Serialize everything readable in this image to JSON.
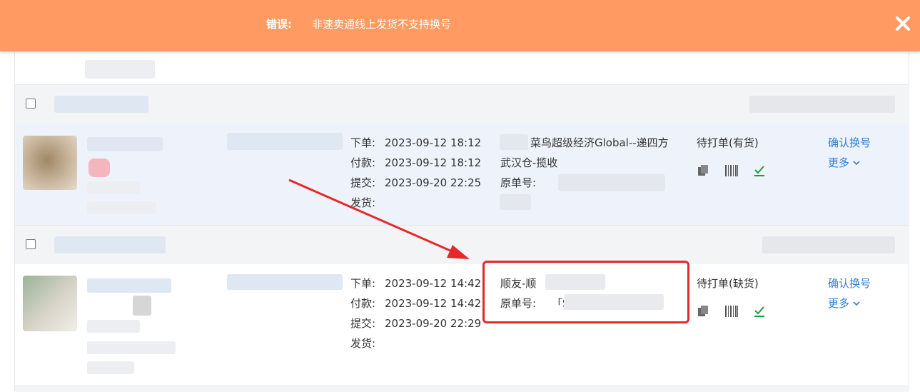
{
  "banner": {
    "label": "错误:",
    "message": "非速卖通线上发货不支持换号",
    "close_icon": "close-icon",
    "bg": "#ff9a62"
  },
  "orders": [
    {
      "times": [
        {
          "label": "下单:",
          "value": "2023-09-12 18:12"
        },
        {
          "label": "付款:",
          "value": "2023-09-12 18:12"
        },
        {
          "label": "提交:",
          "value": "2023-09-20 22:25"
        },
        {
          "label": "发货:",
          "value": ""
        }
      ],
      "shipping": {
        "line1": "菜鸟超级经济Global--递四方",
        "line2": "武汉仓-揽收",
        "orig_label": "原单号:",
        "orig_value": "「"
      },
      "status": "待打单(有货)",
      "actions": {
        "confirm": "确认换号",
        "more": "更多"
      }
    },
    {
      "times": [
        {
          "label": "下单:",
          "value": "2023-09-12 14:42"
        },
        {
          "label": "付款:",
          "value": "2023-09-12 14:42"
        },
        {
          "label": "提交:",
          "value": "2023-09-20 22:29"
        },
        {
          "label": "发货:",
          "value": ""
        }
      ],
      "shipping": {
        "line1": "顺友-顺",
        "orig_label": "原单号:",
        "orig_value": "「S"
      },
      "status": "待打单(缺货)",
      "actions": {
        "confirm": "确认换号",
        "more": "更多"
      }
    }
  ],
  "colors": {
    "link": "#2e7fd6",
    "highlight": "#e6282a",
    "arrow": "#e6282a",
    "check": "#1a9c3a"
  }
}
